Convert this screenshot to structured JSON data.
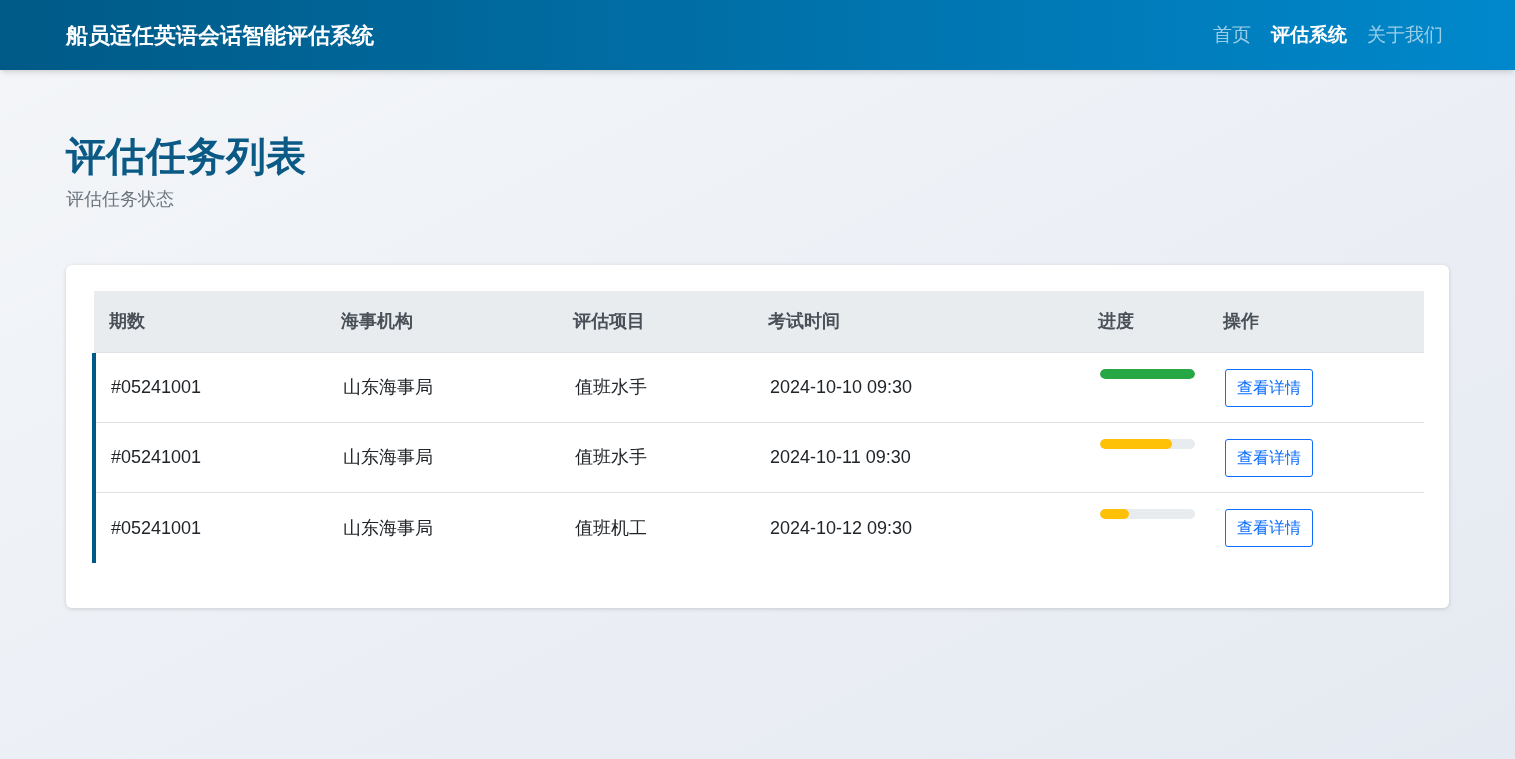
{
  "header": {
    "title": "船员适任英语会话智能评估系统",
    "nav": [
      {
        "label": "首页",
        "selected": false
      },
      {
        "label": "评估系统",
        "selected": true
      },
      {
        "label": "关于我们",
        "selected": false
      }
    ]
  },
  "page": {
    "title": "评估任务列表",
    "subtitle": "评估任务状态"
  },
  "table": {
    "columns": [
      "期数",
      "海事机构",
      "评估项目",
      "考试时间",
      "进度",
      "操作"
    ],
    "rows": [
      {
        "period": "#05241001",
        "agency": "山东海事局",
        "item": "值班水手",
        "time": "2024-10-10 09:30",
        "level": 1,
        "color": "#28a745",
        "action": "查看详情"
      },
      {
        "period": "#05241001",
        "agency": "山东海事局",
        "item": "值班水手",
        "time": "2024-10-11 09:30",
        "level": 0.76,
        "color": "#ffc107",
        "action": "查看详情"
      },
      {
        "period": "#05241001",
        "agency": "山东海事局",
        "item": "值班机工",
        "time": "2024-10-12 09:30",
        "level": 0.3,
        "color": "#ffc107",
        "action": "查看详情"
      }
    ]
  }
}
